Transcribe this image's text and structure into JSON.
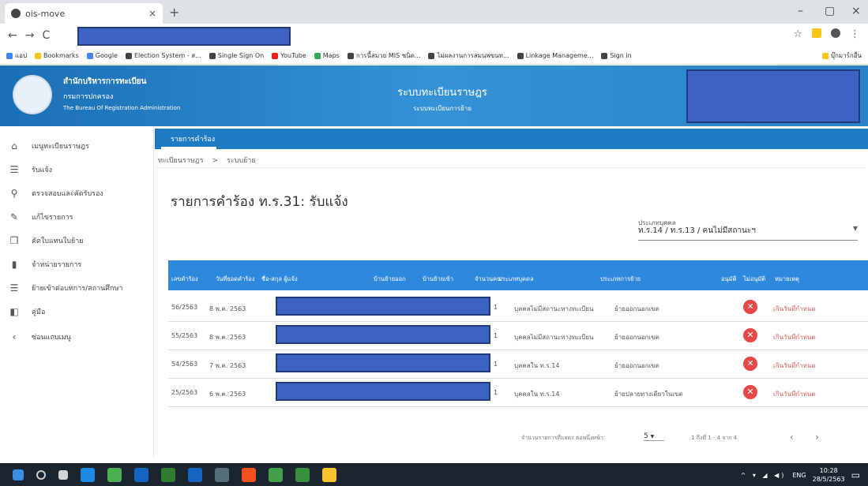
{
  "browser": {
    "tab_title": "ois-move",
    "tab_close": "×",
    "new_tab": "+",
    "win_min": "–",
    "win_max": "▢",
    "win_close": "×",
    "back": "←",
    "forward": "→",
    "reload": "C",
    "star": "☆",
    "menu": "⋮"
  },
  "bookmarks": [
    {
      "label": "แอป",
      "color": "#4285f4"
    },
    {
      "label": "Bookmarks",
      "color": "#f5c518"
    },
    {
      "label": "Google",
      "color": "#4285f4"
    },
    {
      "label": "Election System - ส...",
      "color": "#444"
    },
    {
      "label": "Single Sign On",
      "color": "#444"
    },
    {
      "label": "YouTube",
      "color": "#e62117"
    },
    {
      "label": "Maps",
      "color": "#34a853"
    },
    {
      "label": "การนี้สมวย MIS ชนิด...",
      "color": "#444"
    },
    {
      "label": "ไม่ผลงานการสมนพขนท...",
      "color": "#444"
    },
    {
      "label": "Linkage Manageme...",
      "color": "#444"
    },
    {
      "label": "Sign in",
      "color": "#444"
    },
    {
      "label": "บุ๊กมาร์กอื่น",
      "color": "#f5c518"
    }
  ],
  "header": {
    "org_line1": "สำนักบริหารการทะเบียน",
    "org_line2": "กรมการปกครอง",
    "org_line3": "The Bureau Of Registration Administration",
    "system_title": "ระบบทะเบียนราษฎร",
    "system_subtitle": "ระบบทะเบียนการย้าย"
  },
  "sidebar": {
    "items": [
      {
        "label": "เมนูทะเบียนราษฎร",
        "icon": "⌂"
      },
      {
        "label": "รับแจ้ง",
        "icon": "☰"
      },
      {
        "label": "ตรวจสอบและคัดรับรอง",
        "icon": "⚲"
      },
      {
        "label": "แก้ไขรายการ",
        "icon": "✎"
      },
      {
        "label": "คัดใบแทนใบย้าย",
        "icon": "❐"
      },
      {
        "label": "จำหน่ายรายการ",
        "icon": "▮"
      },
      {
        "label": "ย้ายเข้าต่อบทการ/สถานศึกษา",
        "icon": "☰"
      },
      {
        "label": "คู่มือ",
        "icon": "◧"
      },
      {
        "label": "ซ่อนแถบเมนู",
        "icon": "‹"
      }
    ]
  },
  "main": {
    "tab_label": "รายการคำร้อง",
    "breadcrumb": [
      "ทะเบียนราษฎร",
      "ระบบย้าย"
    ],
    "breadcrumb_sep": ">",
    "title": "รายการคำร้อง ท.ร.31: รับแจ้ง",
    "person_type_label": "ประเภทบุคคล",
    "person_type_value": "ท.ร.14 / ท.ร.13 / คนไม่มีสถานะฯ",
    "caret": "▼"
  },
  "table": {
    "headers": [
      "เลขคำร้อง",
      "วันที่ยอดคำร้อง",
      "ชื่อ-สกุล ผู้แจ้ง",
      "บ้านย้ายออก",
      "บ้านย้ายเข้า",
      "จำนวนคน",
      "ประเภทบุคคล",
      "ประเภทการย้าย",
      "อนุมัติ",
      "ไม่อนุมัติ",
      "หมายเหตุ"
    ],
    "rows": [
      {
        "req": "56/2563",
        "date": "8 พ.ค. 2563",
        "count": "1",
        "ptype": "บุคคลไม่มีสถานะทางทะเบียน",
        "mtype": "ย้ายออกนอกเขต",
        "note": "เกินวันที่กำหนด"
      },
      {
        "req": "55/2563",
        "date": "8 พ.ค. 2563",
        "count": "1",
        "ptype": "บุคคลไม่มีสถานะทางทะเบียน",
        "mtype": "ย้ายออกนอกเขต",
        "note": "เกินวันที่กำหนด"
      },
      {
        "req": "54/2563",
        "date": "7 พ.ค. 2563",
        "count": "1",
        "ptype": "บุคคลใน ท.ร.14",
        "mtype": "ย้ายออกนอกเขต",
        "note": "เกินวันที่กำหนด"
      },
      {
        "req": "25/2563",
        "date": "6 พ.ค. 2563",
        "count": "1",
        "ptype": "บุคคลใน ท.ร.14",
        "mtype": "ย้ายปลายทางเดียวในเขต",
        "note": "เกินวันที่กำหนด"
      }
    ],
    "reject_symbol": "✕"
  },
  "pager": {
    "rows_label": "จำนวนรายการที่แสดง ต่อหนึ่งหน้า:",
    "rows_value": "5",
    "range": "1 ถึงที่ 1 - 4 จาก 4",
    "prev": "‹",
    "next": "›"
  },
  "taskbar": {
    "lang": "ENG",
    "time": "10:28",
    "date": "28/5/2563"
  }
}
